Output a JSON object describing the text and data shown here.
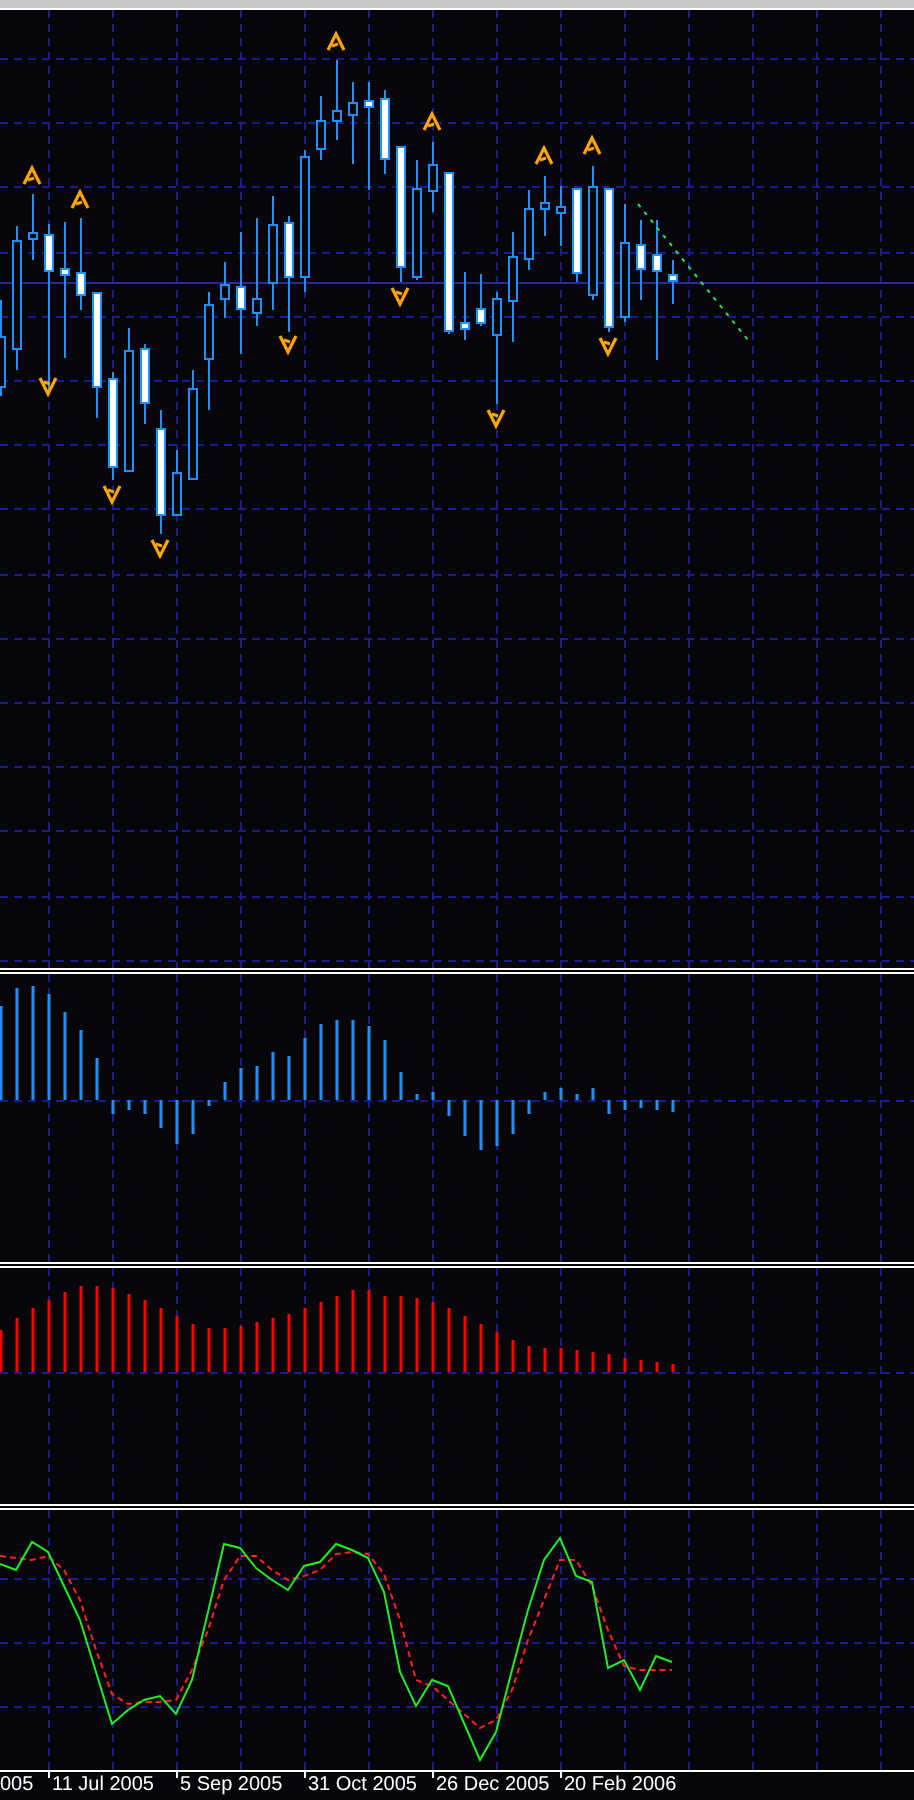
{
  "panes": [
    {
      "kind": "candles"
    },
    {
      "kind": "histogram_blue"
    },
    {
      "kind": "histogram_red"
    },
    {
      "kind": "stochastic"
    }
  ],
  "x_axis": {
    "labels": [
      "005",
      "11 Jul 2005",
      "5 Sep 2005",
      "31 Oct 2005",
      "26 Dec 2005",
      "20 Feb 2006"
    ]
  }
}
